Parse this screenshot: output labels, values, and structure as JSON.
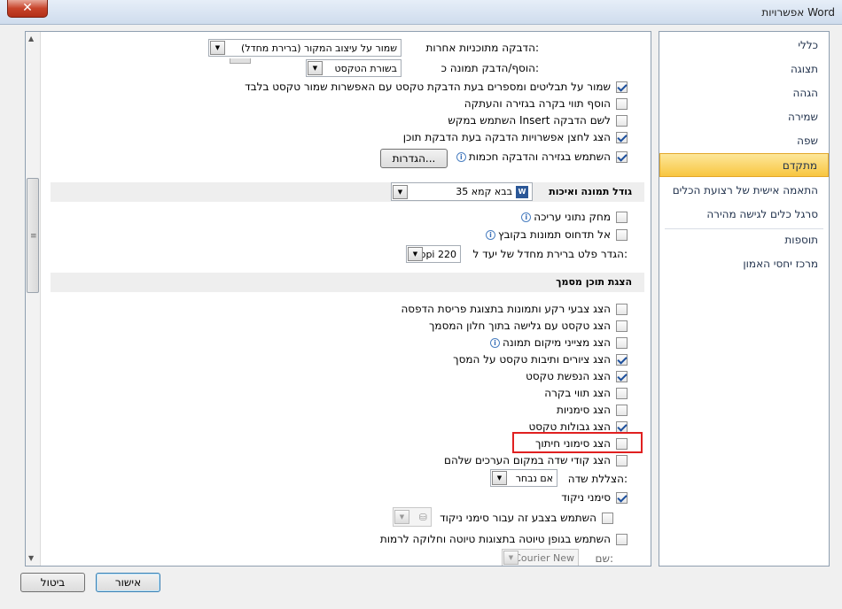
{
  "window": {
    "title": "אפשרויות Word",
    "close_symbol": "✕"
  },
  "sidebar": {
    "items": [
      {
        "label": "כללי"
      },
      {
        "label": "תצוגה"
      },
      {
        "label": "הגהה"
      },
      {
        "label": "שמירה"
      },
      {
        "label": "שפה"
      },
      {
        "label": "מתקדם",
        "active": true
      },
      {
        "label": "התאמה אישית של רצועת הכלים"
      },
      {
        "label": "סרגל כלים לגישה מהירה"
      },
      {
        "label": "תוספות"
      },
      {
        "label": "מרכז יחסי האמון"
      }
    ]
  },
  "paste": {
    "other_programs_label": "הדבקה מתוכניות אחרות:",
    "other_programs_value": "שמור על עיצוב המקור (ברירת מחדל)",
    "insert_picture_label": "הוסף/הדבק תמונה כ:",
    "insert_picture_value": "בשורת הטקסט",
    "keep_bullets": "שמור על תבליטים ומספרים בעת הדבקת טקסט עם האפשרות שמור טקסט בלבד",
    "add_clipboard": "הוסף תווי בקרה בגזירה והעתקה",
    "insert_key": "השתמש במקש Insert לשם הדבקה",
    "show_paste_options": "הצג לחצן אפשרויות הדבקה בעת הדבקת תוכן",
    "smart_cut": "השתמש בגזירה והדבקה חכמות",
    "settings_button": "הגדרות..."
  },
  "image_size": {
    "section_title": "גודל תמונה ואיכות",
    "document_value": "בבא קמא 35",
    "discard_editing": "מחק נתוני עריכה",
    "no_compress": "אל תדחוס תמונות בקובץ",
    "target_output_label": "הגדר פלט ברירת מחדל של יעד ל:",
    "target_output_value": "220 ppi"
  },
  "doc_content": {
    "section_title": "הצגת תוכן מסמך",
    "bg_colors": "הצג צבעי רקע ותמונות בתצוגת פריסת הדפסה",
    "text_wrap": "הצג טקסט עם גלישה בתוך חלון המסמך",
    "picture_placeholders": "הצג מצייני מיקום תמונה",
    "drawings": "הצג ציורים ותיבות טקסט על המסך",
    "text_animation": "הצג הנפשת טקסט",
    "control_chars": "הצג תווי בקרה",
    "bookmarks": "הצג סימניות",
    "text_boundaries": "הצג גבולות טקסט",
    "crop_marks": "הצג סימוני חיתוך",
    "field_codes": "הצג קודי שדה במקום הערכים שלהם",
    "field_shading_label": "הצללת שדה:",
    "field_shading_value": "אם נבחר",
    "nikud_marks": "סימני ניקוד",
    "nikud_color": "השתמש בצבע זה עבור סימני ניקוד",
    "draft_font": "השתמש בגופן טיוטה בתצוגות טיוטה וחלוקה לרמות",
    "name_label": "שם:",
    "name_value": "Courier New"
  },
  "footer": {
    "ok": "אישור",
    "cancel": "ביטול"
  }
}
